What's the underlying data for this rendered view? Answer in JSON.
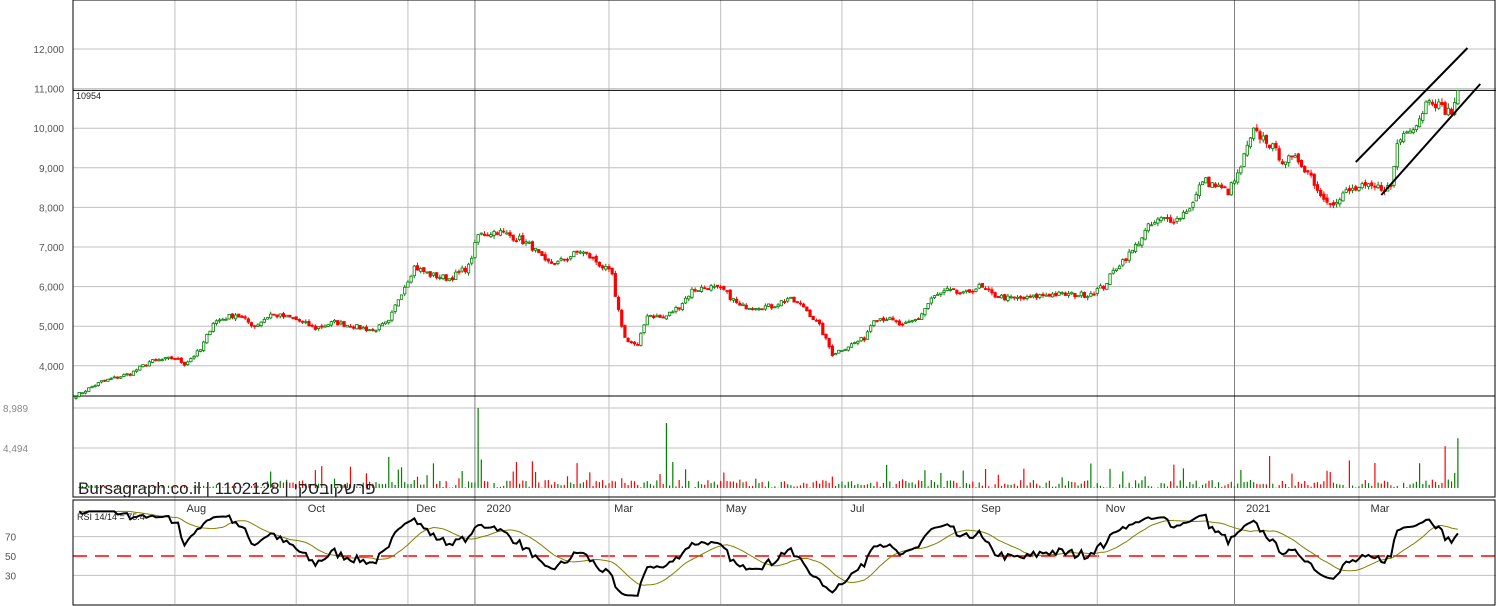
{
  "watermark": "Bursagraph.co.il | 1102128 | פרשקובסקי",
  "chart_data": {
    "type": "candlestick",
    "title": "",
    "price_axis": {
      "ticks": [
        "4,000",
        "5,000",
        "6,000",
        "7,000",
        "8,000",
        "9,000",
        "10,000",
        "11,000",
        "12,000"
      ],
      "tick_values": [
        4000,
        5000,
        6000,
        7000,
        8000,
        9000,
        10000,
        11000,
        12000
      ],
      "ylim": [
        3200,
        13000
      ]
    },
    "last_price_label": "10954",
    "last_price": 10954,
    "xlim": [
      0,
      444
    ],
    "x_unit": "trading session index",
    "month_labels": [
      {
        "label": "Aug",
        "session": 34
      },
      {
        "label": "Oct",
        "session": 72
      },
      {
        "label": "Dec",
        "session": 106
      },
      {
        "label": "2020",
        "session": 128
      },
      {
        "label": "Mar",
        "session": 168
      },
      {
        "label": "May",
        "session": 203
      },
      {
        "label": "Jul",
        "session": 242
      },
      {
        "label": "Sep",
        "session": 283
      },
      {
        "label": "Nov",
        "session": 322
      },
      {
        "label": "2021",
        "session": 366
      },
      {
        "label": "Mar",
        "session": 405
      }
    ],
    "gridline_sessions": [
      31,
      69,
      104,
      125,
      167,
      202,
      240,
      281,
      320,
      363,
      402
    ],
    "year_sessions": [
      125,
      363
    ],
    "close_waypoints": [
      [
        0,
        3250
      ],
      [
        8,
        3600
      ],
      [
        17,
        3800
      ],
      [
        23,
        4100
      ],
      [
        31,
        4200
      ],
      [
        34,
        4050
      ],
      [
        39,
        4400
      ],
      [
        43,
        5100
      ],
      [
        50,
        5300
      ],
      [
        56,
        5000
      ],
      [
        61,
        5300
      ],
      [
        68,
        5200
      ],
      [
        75,
        4950
      ],
      [
        81,
        5100
      ],
      [
        87,
        5000
      ],
      [
        93,
        4900
      ],
      [
        98,
        5100
      ],
      [
        101,
        5700
      ],
      [
        106,
        6500
      ],
      [
        111,
        6300
      ],
      [
        117,
        6200
      ],
      [
        123,
        6500
      ],
      [
        126,
        7300
      ],
      [
        132,
        7400
      ],
      [
        139,
        7200
      ],
      [
        143,
        7000
      ],
      [
        147,
        6600
      ],
      [
        151,
        6600
      ],
      [
        158,
        6900
      ],
      [
        162,
        6700
      ],
      [
        168,
        6300
      ],
      [
        169,
        5700
      ],
      [
        172,
        4700
      ],
      [
        176,
        4500
      ],
      [
        179,
        5300
      ],
      [
        184,
        5200
      ],
      [
        189,
        5500
      ],
      [
        193,
        5900
      ],
      [
        198,
        6000
      ],
      [
        203,
        5900
      ],
      [
        208,
        5500
      ],
      [
        214,
        5500
      ],
      [
        218,
        5500
      ],
      [
        223,
        5700
      ],
      [
        228,
        5500
      ],
      [
        233,
        5000
      ],
      [
        237,
        4300
      ],
      [
        242,
        4500
      ],
      [
        247,
        4700
      ],
      [
        250,
        5200
      ],
      [
        254,
        5200
      ],
      [
        259,
        5000
      ],
      [
        264,
        5200
      ],
      [
        268,
        5700
      ],
      [
        273,
        5900
      ],
      [
        278,
        5800
      ],
      [
        283,
        6000
      ],
      [
        287,
        5800
      ],
      [
        292,
        5700
      ],
      [
        298,
        5700
      ],
      [
        304,
        5800
      ],
      [
        311,
        5800
      ],
      [
        317,
        5800
      ],
      [
        322,
        6000
      ],
      [
        326,
        6500
      ],
      [
        331,
        6900
      ],
      [
        336,
        7500
      ],
      [
        340,
        7700
      ],
      [
        345,
        7700
      ],
      [
        350,
        8100
      ],
      [
        353,
        8700
      ],
      [
        358,
        8500
      ],
      [
        361,
        8400
      ],
      [
        364,
        8800
      ],
      [
        367,
        9500
      ],
      [
        369,
        9900
      ],
      [
        373,
        9700
      ],
      [
        378,
        9200
      ],
      [
        383,
        9200
      ],
      [
        387,
        8800
      ],
      [
        390,
        8300
      ],
      [
        395,
        8100
      ],
      [
        398,
        8400
      ],
      [
        403,
        8500
      ],
      [
        408,
        8500
      ],
      [
        412,
        8500
      ],
      [
        414,
        9600
      ],
      [
        417,
        10000
      ],
      [
        420,
        10100
      ],
      [
        424,
        10800
      ],
      [
        428,
        10500
      ],
      [
        431,
        10400
      ],
      [
        433,
        10954
      ]
    ],
    "trend_lines": [
      {
        "name": "upper-channel",
        "from": [
          401,
          9146
        ],
        "to": [
          436,
          12025
        ]
      },
      {
        "name": "lower-channel",
        "from": [
          409,
          8313
        ],
        "to": [
          440,
          11116
        ]
      }
    ],
    "volume": {
      "ticks": [
        "4,494",
        "8,989"
      ],
      "tick_values": [
        4494,
        8989
      ],
      "spikes": [
        [
          98,
          3500
        ],
        [
          126,
          8989
        ],
        [
          127,
          3200
        ],
        [
          143,
          3000
        ],
        [
          185,
          7300
        ],
        [
          429,
          4700
        ],
        [
          433,
          5600
        ],
        [
          374,
          3600
        ],
        [
          399,
          3100
        ]
      ]
    },
    "rsi": {
      "label": "RSI 14/14 = 75.4",
      "period": 14,
      "value": 75.4,
      "ticks": [
        "70",
        "50",
        "30"
      ],
      "tick_values": [
        70,
        50,
        30
      ],
      "reference_level": 50
    },
    "colors": {
      "up": "#008000",
      "down": "#ff0000",
      "rsi": "#000000",
      "rsi_ma": "#808000",
      "grid": "#c0c0c0"
    }
  }
}
